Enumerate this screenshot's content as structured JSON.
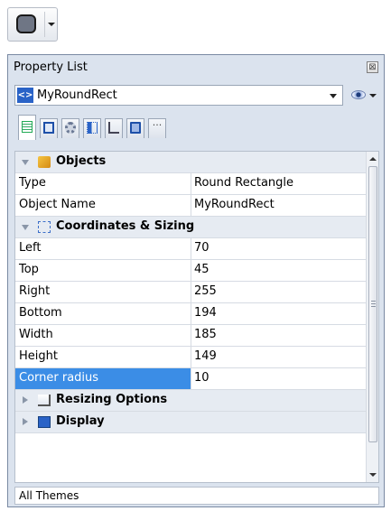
{
  "toolbar": {
    "shape_button_icon": "round-rectangle-icon"
  },
  "panel": {
    "title": "Property List",
    "close_glyph": "⊠",
    "object_selector": {
      "value": "MyRoundRect",
      "icon_glyph": "<>"
    },
    "tabs": [
      {
        "icon": "list-icon",
        "active": true
      },
      {
        "icon": "window-icon"
      },
      {
        "icon": "gear-icon"
      },
      {
        "icon": "shapes-icon"
      },
      {
        "icon": "chart-icon"
      },
      {
        "icon": "monitor-icon"
      },
      {
        "icon": "more-icon",
        "glyph": "···"
      }
    ],
    "categories": {
      "objects": "Objects",
      "coordinates": "Coordinates & Sizing",
      "resizing": "Resizing Options",
      "display": "Display"
    },
    "properties": {
      "type": {
        "name": "Type",
        "value": "Round Rectangle"
      },
      "object_name": {
        "name": "Object Name",
        "value": "MyRoundRect"
      },
      "left": {
        "name": "Left",
        "value": "70"
      },
      "top": {
        "name": "Top",
        "value": "45"
      },
      "right": {
        "name": "Right",
        "value": "255"
      },
      "bottom": {
        "name": "Bottom",
        "value": "194"
      },
      "width": {
        "name": "Width",
        "value": "185"
      },
      "height": {
        "name": "Height",
        "value": "149"
      },
      "corner_radius": {
        "name": "Corner radius",
        "value": "10"
      }
    },
    "status": "All Themes"
  }
}
